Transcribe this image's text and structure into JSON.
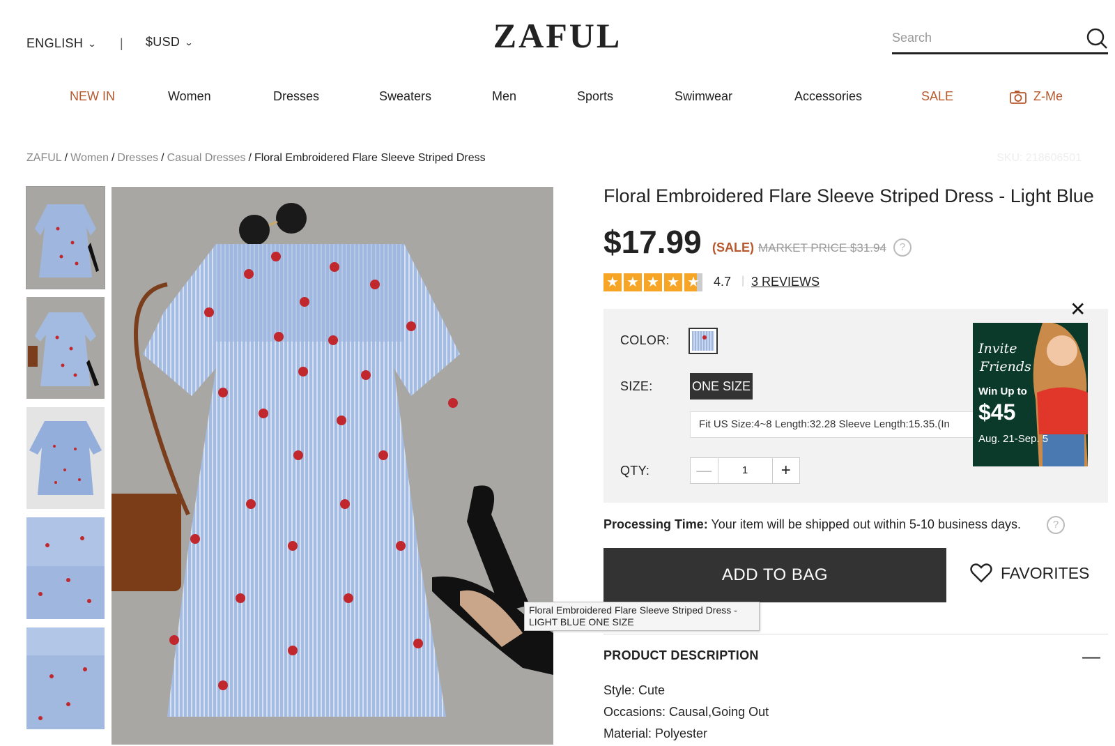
{
  "header": {
    "language": "ENGLISH",
    "currency": "$USD",
    "separator": "|",
    "logo": "ZAFUL",
    "search_placeholder": "Search"
  },
  "nav": [
    {
      "label": "NEW IN",
      "highlight": true
    },
    {
      "label": "Women"
    },
    {
      "label": "Dresses"
    },
    {
      "label": "Sweaters"
    },
    {
      "label": "Men"
    },
    {
      "label": "Sports"
    },
    {
      "label": "Swimwear"
    },
    {
      "label": "Accessories"
    },
    {
      "label": "SALE",
      "highlight": true
    },
    {
      "label": "Z-Me",
      "highlight": true,
      "icon": "camera-icon"
    }
  ],
  "breadcrumb": {
    "items": [
      "ZAFUL",
      "Women",
      "Dresses",
      "Casual Dresses"
    ],
    "current": "Floral Embroidered Flare Sleeve Striped Dress",
    "sku": "SKU: 218606501"
  },
  "product": {
    "title": "Floral Embroidered Flare Sleeve Striped Dress - Light Blue",
    "price": "$17.99",
    "sale_label": "(SALE)",
    "market_price": "MARKET PRICE $31.94",
    "rating": "4.7",
    "reviews": "3 REVIEWS",
    "stars": 4.7
  },
  "options": {
    "color_label": "COLOR:",
    "size_label": "SIZE:",
    "size_value": "ONE SIZE",
    "size_info": "Fit US Size:4~8   Length:32.28   Sleeve Length:15.35.(In",
    "qty_label": "QTY:",
    "qty_minus": "—",
    "qty_value": "1",
    "qty_plus": "+"
  },
  "promo": {
    "line1": "Invite",
    "line2": "Friends",
    "line3": "Win Up to",
    "amount": "$45",
    "dates": "Aug. 21-Sep. 5",
    "close": "✕"
  },
  "processing": {
    "label": "Processing Time:",
    "text": "Your item will be shipped out within 5-10 business days."
  },
  "actions": {
    "add_to_bag": "ADD TO BAG",
    "favorites": "FAVORITES"
  },
  "tooltip": {
    "line1": "Floral Embroidered Flare Sleeve Striped Dress -",
    "line2": "LIGHT BLUE ONE SIZE"
  },
  "description": {
    "heading": "PRODUCT DESCRIPTION",
    "toggle": "—",
    "style": "Style: Cute",
    "occasions": "Occasions: Causal,Going Out",
    "material": "Material: Polyester"
  },
  "colors": {
    "accent": "#b7582c",
    "dark_button": "#333333",
    "star": "#f7a527",
    "dress_blue": "#9fb7de"
  }
}
